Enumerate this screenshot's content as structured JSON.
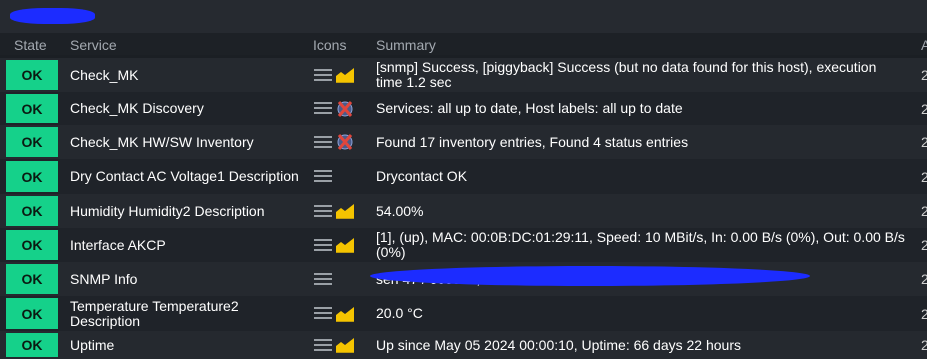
{
  "table": {
    "headers": {
      "state": "State",
      "service": "Service",
      "icons": "Icons",
      "summary": "Summary",
      "age": "A"
    },
    "rows": [
      {
        "state": "OK",
        "service": "Check_MK",
        "summary": "[snmp] Success, [piggyback] Success (but no data found for this host), execution time 1.2 sec",
        "age": "2",
        "icons": [
          "menu-icon",
          "graph-icon"
        ]
      },
      {
        "state": "OK",
        "service": "Check_MK Discovery",
        "summary": "Services: all up to date, Host labels: all up to date",
        "age": "2",
        "icons": [
          "menu-icon",
          "disabled-icon"
        ]
      },
      {
        "state": "OK",
        "service": "Check_MK HW/SW Inventory",
        "summary": "Found 17 inventory entries, Found 4 status entries",
        "age": "2",
        "icons": [
          "menu-icon",
          "disabled-icon"
        ]
      },
      {
        "state": "OK",
        "service": "Dry Contact AC Voltage1 Description",
        "summary": "Drycontact OK",
        "age": "2",
        "icons": [
          "menu-icon"
        ]
      },
      {
        "state": "OK",
        "service": "Humidity Humidity2 Description",
        "summary": "54.00%",
        "age": "2",
        "icons": [
          "menu-icon",
          "graph-icon"
        ]
      },
      {
        "state": "OK",
        "service": "Interface AKCP",
        "summary": "[1], (up), MAC: 00:0B:DC:01:29:11, Speed: 10 MBit/s, In: 0.00 B/s (0%), Out: 0.00 B/s (0%)",
        "age": "2",
        "icons": [
          "menu-icon",
          "graph-icon"
        ]
      },
      {
        "state": "OK",
        "service": "SNMP Info",
        "summary": "sen                  47 / 009917, sensa                  0 20020  nix-Sun",
        "age": "2",
        "icons": [
          "menu-icon"
        ]
      },
      {
        "state": "OK",
        "service": "Temperature Temperature2 Description",
        "summary": "20.0 °C",
        "age": "2",
        "icons": [
          "menu-icon",
          "graph-icon"
        ]
      },
      {
        "state": "OK",
        "service": "Uptime",
        "summary": "Up since May 05 2024 00:00:10, Uptime: 66 days 22 hours",
        "age": "2",
        "icons": [
          "menu-icon",
          "graph-icon"
        ]
      }
    ]
  },
  "colors": {
    "ok": "#15d18a",
    "graph": "#f5c400",
    "disabled": "#e0463c",
    "redaction": "#1c2cff"
  }
}
